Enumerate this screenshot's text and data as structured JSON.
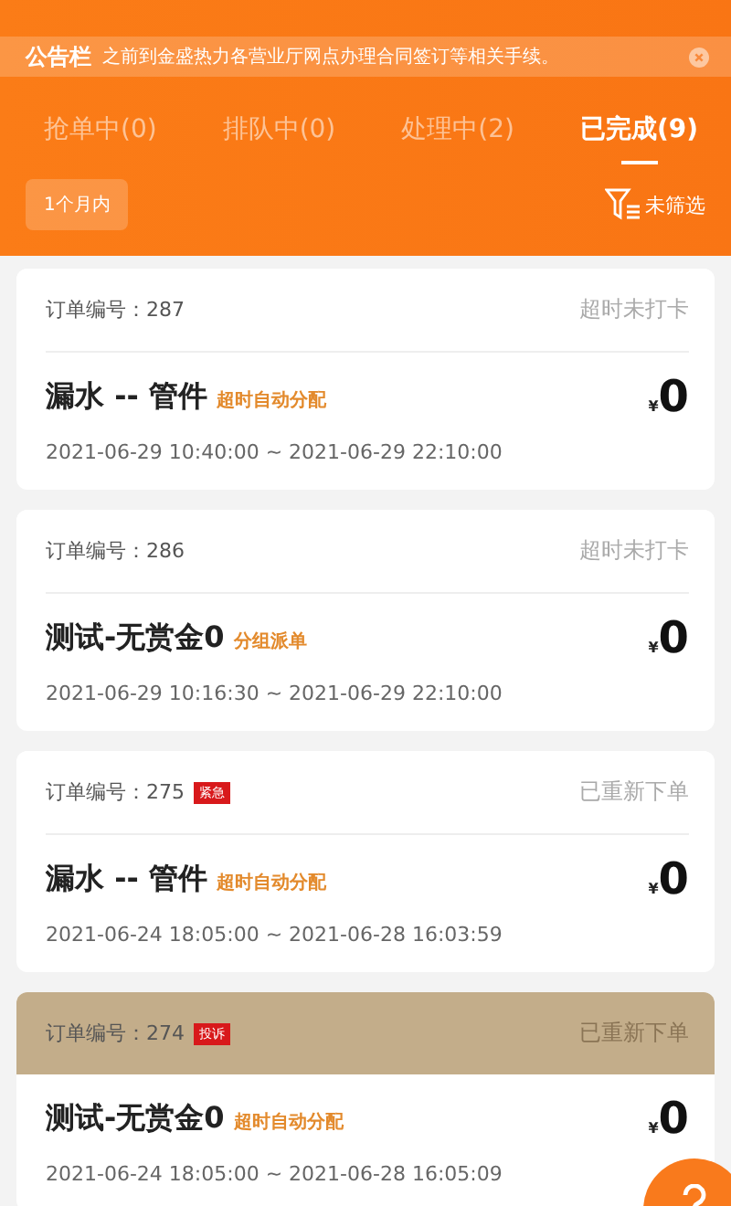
{
  "notice": {
    "label": "公告栏",
    "text": "之前到金盛热力各营业厅网点办理合同签订等相关手续。"
  },
  "tabs": [
    {
      "label": "抢单中(0)",
      "selected": false
    },
    {
      "label": "排队中(0)",
      "selected": false
    },
    {
      "label": "处理中(2)",
      "selected": false
    },
    {
      "label": "已完成(9)",
      "selected": true
    }
  ],
  "period": "1个月内",
  "filter": "未筛选",
  "orders": [
    {
      "number_label": "订单编号：287",
      "status": "超时未打卡",
      "title": "漏水 -- 管件",
      "assign": "超时自动分配",
      "currency": "¥",
      "price": "0",
      "time": "2021-06-29 10:40:00 ~ 2021-06-29 22:10:00",
      "highlighted": false
    },
    {
      "number_label": "订单编号：286",
      "status": "超时未打卡",
      "title": "测试-无赏金0",
      "assign": "分组派单",
      "currency": "¥",
      "price": "0",
      "time": "2021-06-29 10:16:30 ~ 2021-06-29 22:10:00",
      "highlighted": false
    },
    {
      "number_label": "订单编号：275",
      "badge": "紧急",
      "status": "已重新下单",
      "title": "漏水 -- 管件",
      "assign": "超时自动分配",
      "currency": "¥",
      "price": "0",
      "time": "2021-06-24 18:05:00 ~ 2021-06-28 16:03:59",
      "highlighted": false
    },
    {
      "number_label": "订单编号：274",
      "badge": "投诉",
      "status": "已重新下单",
      "title": "测试-无赏金0",
      "assign": "超时自动分配",
      "currency": "¥",
      "price": "0",
      "time": "2021-06-24 18:05:00 ~ 2021-06-28 16:05:09",
      "highlighted": true
    }
  ]
}
